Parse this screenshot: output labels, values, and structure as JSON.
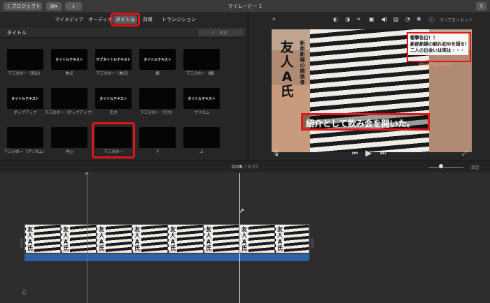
{
  "titlebar": {
    "back_label": "〈 プロジェクト",
    "project_title": "マイムービー 1",
    "media_icon": "film-strip-icon",
    "import_icon": "import-arrow-icon",
    "share_icon": "share-icon"
  },
  "browser": {
    "tabs": [
      {
        "label": "マイメディア",
        "active": false
      },
      {
        "label": "オーディオ",
        "active": false
      },
      {
        "label": "タイトル",
        "active": true
      },
      {
        "label": "背景",
        "active": false
      },
      {
        "label": "トランジション",
        "active": false
      }
    ],
    "section_title": "タイトル",
    "search_placeholder": "検索",
    "titles": [
      {
        "thumb_text": "",
        "label": "下三分の一（見出）"
      },
      {
        "thumb_text": "タイトルテキスト",
        "label": "焦点"
      },
      {
        "thumb_text": "サブタイトルテキスト",
        "label": "下三分の一（焦点）"
      },
      {
        "thumb_text": "タイトルテキスト",
        "label": "線"
      },
      {
        "thumb_text": "",
        "label": "下三分の一（線）"
      },
      {
        "thumb_text": "タイトルテキスト",
        "label": "ポップアップ"
      },
      {
        "thumb_text": "",
        "label": "下三分の一（ポップアップ）"
      },
      {
        "thumb_text": "タイトルテキスト",
        "label": "引力"
      },
      {
        "thumb_text": "",
        "label": "下三分の一（引力）"
      },
      {
        "thumb_text": "タイトルテキスト",
        "label": "プリズム"
      },
      {
        "thumb_text": "",
        "label": "下三分の一（プリズム）"
      },
      {
        "thumb_text": "",
        "label": "中心"
      },
      {
        "thumb_text": "",
        "label": "下三分の一"
      },
      {
        "thumb_text": "",
        "label": "下"
      },
      {
        "thumb_text": "",
        "label": "上"
      }
    ]
  },
  "viewer": {
    "reset_label": "すべてをリセット",
    "video": {
      "vertical_title": "友人A氏",
      "vertical_subtitle": "新郎新婦の関係者",
      "headline_lines": [
        "衝撃告白！！",
        "新郎新婦の馴れ初めを語る！",
        "二人の出会いは実は・・・"
      ],
      "brand": "Wedding News",
      "subtitle": "紹介として飲み会を開いた。"
    }
  },
  "timeline": {
    "current_time": "0:06",
    "separator": " / ",
    "total_time": "0:27",
    "settings_label": "設定",
    "clip_frame_label": "友人A氏"
  }
}
